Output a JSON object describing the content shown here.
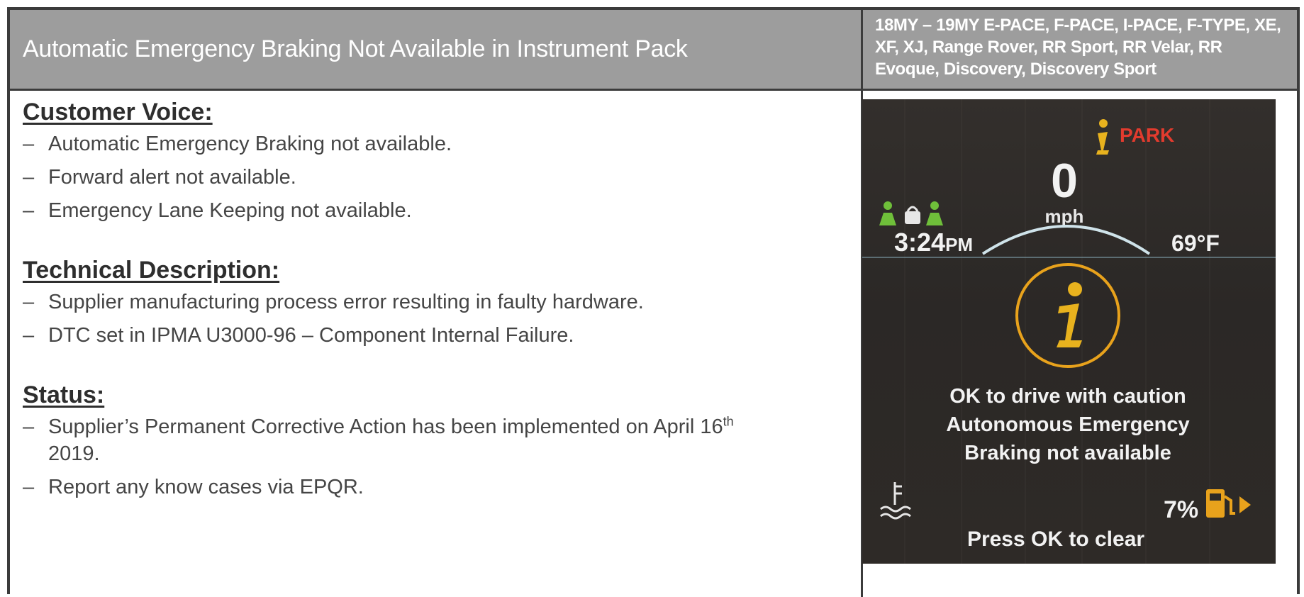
{
  "header": {
    "title": "Automatic Emergency Braking Not Available in Instrument Pack",
    "models": "18MY – 19MY E-PACE, F-PACE, I-PACE, F-TYPE, XE, XF, XJ, Range Rover, RR Sport, RR Velar, RR Evoque, Discovery, Discovery Sport"
  },
  "customer_voice": {
    "heading": "Customer Voice:",
    "items": [
      "Automatic Emergency Braking not available.",
      "Forward alert not available.",
      "Emergency Lane Keeping not available."
    ]
  },
  "technical_description": {
    "heading": "Technical Description:",
    "items": [
      "Supplier manufacturing process error resulting in faulty hardware.",
      "DTC set in IPMA U3000-96 – Component Internal Failure."
    ]
  },
  "status": {
    "heading": "Status:",
    "item1_pre": "Supplier’s Permanent Corrective Action has been implemented on April 16",
    "item1_sup": "th",
    "item1_post": "2019.",
    "item2": "Report any know cases via EPQR."
  },
  "bullet_dash": "–",
  "cluster": {
    "park": "PARK",
    "speed": "0",
    "speed_unit": "mph",
    "time": "3:24",
    "time_suffix": "PM",
    "temperature": "69°F",
    "message_line1": "OK to drive with caution",
    "message_line2": "Autonomous Emergency",
    "message_line3": "Braking not available",
    "fuel_percent": "7%",
    "clear_prompt": "Press OK to clear",
    "icons": [
      "info-icon",
      "seatbelt-icon",
      "coolant-temperature-icon",
      "fuel-pump-icon"
    ],
    "colors": {
      "warning_amber": "#e8a21c",
      "park_red": "#e23b2e",
      "seatbelt_green": "#6fbf3a"
    }
  }
}
